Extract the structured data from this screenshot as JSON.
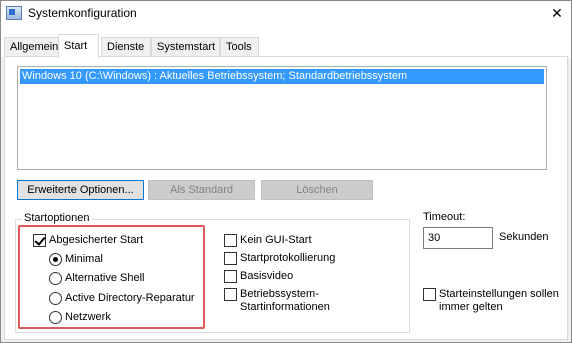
{
  "window": {
    "title": "Systemkonfiguration",
    "close_glyph": "✕"
  },
  "tabs": [
    {
      "label": "Allgemein",
      "active": false
    },
    {
      "label": "Start",
      "active": true
    },
    {
      "label": "Dienste",
      "active": false
    },
    {
      "label": "Systemstart",
      "active": false
    },
    {
      "label": "Tools",
      "active": false
    }
  ],
  "boot_list": {
    "entries": [
      "Windows 10 (C:\\Windows) : Aktuelles Betriebssystem; Standardbetriebssystem"
    ],
    "selected_index": 0
  },
  "buttons": {
    "advanced": "Erweiterte Optionen...",
    "set_default": "Als Standard",
    "delete": "Löschen"
  },
  "boot_options": {
    "group_label": "Startoptionen",
    "safe_boot": {
      "label": "Abgesicherter Start",
      "checked": true
    },
    "safe_modes": [
      {
        "label": "Minimal",
        "checked": true
      },
      {
        "label": "Alternative Shell",
        "checked": false
      },
      {
        "label": "Active Directory-Reparatur",
        "checked": false
      },
      {
        "label": "Netzwerk",
        "checked": false
      }
    ],
    "no_gui": {
      "label": "Kein GUI-Start",
      "checked": false
    },
    "boot_log": {
      "label": "Startprotokollierung",
      "checked": false
    },
    "base_video": {
      "label": "Basisvideo",
      "checked": false
    },
    "os_boot_info": {
      "label_line1": "Betriebssystem-",
      "label_line2": "Startinformationen",
      "checked": false
    }
  },
  "timeout": {
    "label": "Timeout:",
    "value": "30",
    "unit": "Sekunden"
  },
  "permanent": {
    "label_line1": "Starteinstellungen sollen",
    "label_line2": "immer gelten",
    "checked": false
  },
  "colors": {
    "selection": "#3399ff",
    "highlight_box": "#e0595a"
  }
}
